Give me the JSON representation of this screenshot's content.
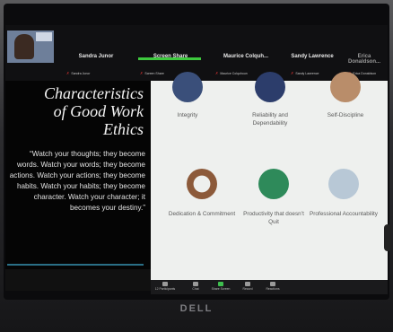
{
  "participants": [
    {
      "name": "Sandra Junor",
      "sub": "Sandra Junor"
    },
    {
      "name": "Screen Share",
      "sub": "Screen Share"
    },
    {
      "name": "Maurice Colquh...",
      "sub": "Maurice Colquhoun"
    },
    {
      "name": "Sandy Lawrence",
      "sub": "Sandy Lawrence"
    },
    {
      "name": "Erica Donaldson...",
      "sub": "Erica Donaldson"
    }
  ],
  "slide": {
    "title_line1": "Characteristics",
    "title_line2": "of Good Work",
    "title_line3": "Ethics",
    "quote": "“Watch your thoughts; they become words. Watch your words; they become actions. Watch your actions; they become habits. Watch your habits; they become character. Watch your character; it becomes your destiny.”"
  },
  "traits": [
    {
      "label": "Integrity",
      "icon": "hands-icon",
      "color": "#3a4f7a"
    },
    {
      "label": "Reliability and Dependability",
      "icon": "team-icon",
      "color": "#2c3d6b"
    },
    {
      "label": "Self-Discipline",
      "icon": "figure-icon",
      "color": "#b98d6a"
    },
    {
      "label": "Dedication & Commitment",
      "icon": "hands-circle-icon",
      "color": "#8c5a3a"
    },
    {
      "label": "Productivity that doesn’t Quit",
      "icon": "productivity-icon",
      "color": "#2e8a5a"
    },
    {
      "label": "Professional Accountability",
      "icon": "handshake-icon",
      "color": "#b8c8d6"
    }
  ],
  "toolbar": [
    {
      "label": "Participants"
    },
    {
      "label": "Chat"
    },
    {
      "label": "Share Screen"
    },
    {
      "label": "Record"
    },
    {
      "label": "Reactions"
    }
  ],
  "participant_count": "12",
  "brand": "DELL"
}
